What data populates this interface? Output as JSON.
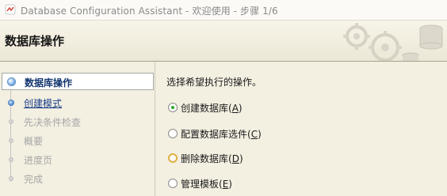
{
  "window": {
    "title": "Database Configuration Assistant - 欢迎使用 - 步骤 1/6"
  },
  "header": {
    "title": "数据库操作"
  },
  "steps": [
    {
      "label": "数据库操作",
      "state": "current"
    },
    {
      "label": "创建模式",
      "state": "link"
    },
    {
      "label": "先决条件检查",
      "state": "disabled"
    },
    {
      "label": "概要",
      "state": "disabled"
    },
    {
      "label": "进度页",
      "state": "disabled"
    },
    {
      "label": "完成",
      "state": "disabled"
    }
  ],
  "main": {
    "prompt": "选择希望执行的操作。",
    "options": [
      {
        "label": "创建数据库(",
        "mnemonic": "A",
        "close": ")",
        "selected": true
      },
      {
        "label": "配置数据库选件(",
        "mnemonic": "C",
        "close": ")",
        "selected": false
      },
      {
        "label": "删除数据库(",
        "mnemonic": "D",
        "close": ")",
        "selected": false
      },
      {
        "label": "管理模板(",
        "mnemonic": "E",
        "close": ")",
        "selected": false
      }
    ]
  },
  "colors": {
    "background": "#f3efe1",
    "link": "#1a3f8a",
    "current_step": "#14366f",
    "radio_selected": "#2ea82e",
    "radio_focus": "#e0b040"
  },
  "icons": {
    "app": "oracle-app-icon",
    "header_art": "gears-and-database-art"
  }
}
